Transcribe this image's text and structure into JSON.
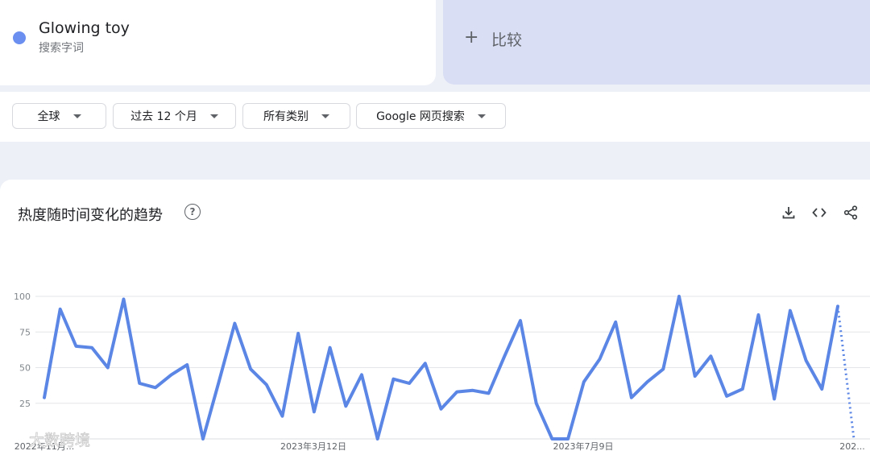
{
  "term": {
    "name": "Glowing toy",
    "type": "搜索字词",
    "color": "#6b8ff0"
  },
  "compare": {
    "plus": "+",
    "label": "比较"
  },
  "filters": [
    {
      "label": "全球"
    },
    {
      "label": "过去 12 个月"
    },
    {
      "label": "所有类别"
    },
    {
      "label": "Google 网页搜索"
    }
  ],
  "chart_card": {
    "title": "热度随时间变化的趋势",
    "help": "?"
  },
  "icons": {
    "download": "download-icon",
    "embed": "embed-code-icon",
    "share": "share-icon",
    "help": "help-circle-icon"
  },
  "watermark": "大数跨境",
  "chart_data": {
    "type": "line",
    "title": "",
    "ylim": [
      0,
      100
    ],
    "yticks": [
      25,
      50,
      75,
      100
    ],
    "xtick_labels": [
      "2022年11月...",
      "2023年3月12日",
      "2023年7月9日",
      "202..."
    ],
    "series": [
      {
        "color": "#5b86e5",
        "values": [
          29,
          91,
          65,
          64,
          50,
          98,
          39,
          36,
          45,
          52,
          0,
          40,
          81,
          49,
          38,
          16,
          74,
          19,
          64,
          23,
          45,
          0,
          42,
          39,
          53,
          21,
          33,
          34,
          32,
          58,
          83,
          25,
          0,
          0,
          40,
          56,
          82,
          29,
          40,
          49,
          100,
          44,
          58,
          30,
          35,
          87,
          28,
          90,
          55,
          35,
          93
        ],
        "partial_last": 0
      }
    ],
    "grid": true
  }
}
